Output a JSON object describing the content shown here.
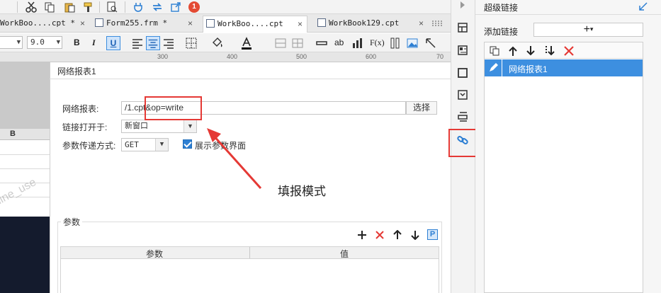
{
  "tabs": [
    {
      "label": "WorkBoo....cpt *",
      "close": "×"
    },
    {
      "label": "Form255.frm *",
      "close": "×"
    },
    {
      "label": "WorkBoo....cpt",
      "close": "×"
    },
    {
      "label": "WorkBook129.cpt",
      "close": "×"
    }
  ],
  "toolbar": {
    "notification_badge": "1"
  },
  "format_bar": {
    "font_size": "9.0",
    "bold": "B",
    "italic": "I",
    "underline": "U",
    "text_btn": "ab",
    "formula_btn": "F(x)"
  },
  "ruler": [
    "300",
    "400",
    "500",
    "600",
    "70"
  ],
  "sheet": {
    "column_b": "B"
  },
  "watermark": "line_use",
  "dialog": {
    "title": "网络报表1",
    "report_label": "网络报表:",
    "report_value": "/1.cpt&op=write",
    "select_button": "选择",
    "open_in_label": "链接打开于:",
    "open_in_value": "新窗口",
    "param_method_label": "参数传递方式:",
    "param_method_value": "GET",
    "show_param_label": "展示参数界面",
    "show_param_checked": true,
    "params_group_title": "参数",
    "param_col_name": "参数",
    "param_col_value": "值"
  },
  "annotation": {
    "text": "填报模式",
    "color": "#e53935"
  },
  "panel": {
    "title": "超级链接",
    "add_label": "添加链接",
    "add_button": "+",
    "items": [
      {
        "label": "网络报表1",
        "selected": true
      }
    ]
  },
  "colors": {
    "selection": "#3d8fe0",
    "highlight_red": "#e53935",
    "accent_blue": "#2d7fd3"
  }
}
